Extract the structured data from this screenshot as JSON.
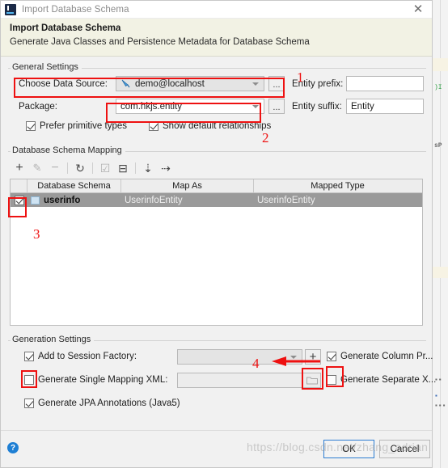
{
  "window": {
    "title": "Import Database Schema",
    "app_icon": "intellij-idea-icon",
    "close_icon": "close-icon"
  },
  "header": {
    "title": "Import Database Schema",
    "subtitle": "Generate Java Classes and Persistence Metadata for Database Schema"
  },
  "general_settings": {
    "group_title": "General Settings",
    "data_source_label": "Choose Data Source:",
    "data_source_value": "demo@localhost",
    "data_source_icon": "database-connection-icon",
    "data_source_browse": "...",
    "package_label": "Package:",
    "package_value": "com.hkjs.entity",
    "package_browse": "...",
    "entity_prefix_label": "Entity prefix:",
    "entity_prefix_value": "",
    "entity_prefix_placeholder": "",
    "entity_suffix_label": "Entity suffix:",
    "entity_suffix_value": "Entity",
    "prefer_primitive_label": "Prefer primitive types",
    "prefer_primitive_checked": true,
    "show_default_rel_label": "Show default relationships",
    "show_default_rel_checked": true
  },
  "schema_mapping": {
    "group_title": "Database Schema Mapping",
    "toolbar": [
      {
        "name": "add-icon",
        "glyph": "+",
        "enabled": true
      },
      {
        "name": "edit-pencil-icon",
        "glyph": "✎",
        "enabled": false
      },
      {
        "name": "remove-icon",
        "glyph": "−",
        "enabled": false
      },
      {
        "name": "refresh-icon",
        "glyph": "↻",
        "enabled": true
      },
      {
        "name": "select-all-icon",
        "glyph": "☑",
        "enabled": false
      },
      {
        "name": "deselect-all-icon",
        "glyph": "⊟",
        "enabled": true
      },
      {
        "name": "expand-all-icon",
        "glyph": "⤓",
        "enabled": true
      },
      {
        "name": "collapse-all-icon",
        "glyph": "⤒",
        "enabled": true
      }
    ],
    "columns": [
      "Database Schema",
      "Map As",
      "Mapped Type"
    ],
    "rows": [
      {
        "checked": true,
        "schema": "userinfo",
        "schema_icon": "table-icon",
        "map_as": "UserinfoEntity",
        "mapped_type": "UserinfoEntity"
      }
    ]
  },
  "generation_settings": {
    "group_title": "Generation Settings",
    "add_session_factory_label": "Add to Session Factory:",
    "add_session_factory_checked": true,
    "add_session_factory_value": "",
    "add_session_factory_plus": "+",
    "generate_column_label": "Generate Column Pr...",
    "generate_column_checked": true,
    "generate_single_xml_label": "Generate Single Mapping XML:",
    "generate_single_xml_checked": false,
    "generate_single_xml_value": "",
    "generate_single_xml_browse_icon": "folder-icon",
    "generate_separate_label": "Generate Separate X...",
    "generate_separate_checked": false,
    "generate_jpa_label": "Generate JPA Annotations (Java5)",
    "generate_jpa_checked": true
  },
  "footer": {
    "help_icon": "help-icon",
    "help_glyph": "?",
    "ok_label": "OK",
    "cancel_label": "Cancel"
  },
  "annotations": {
    "accent_color": "#ee1111",
    "markers": [
      "1",
      "2",
      "3",
      "4"
    ]
  },
  "watermark": {
    "text": "https://blog.csdn.net/zhang_adrian"
  }
}
